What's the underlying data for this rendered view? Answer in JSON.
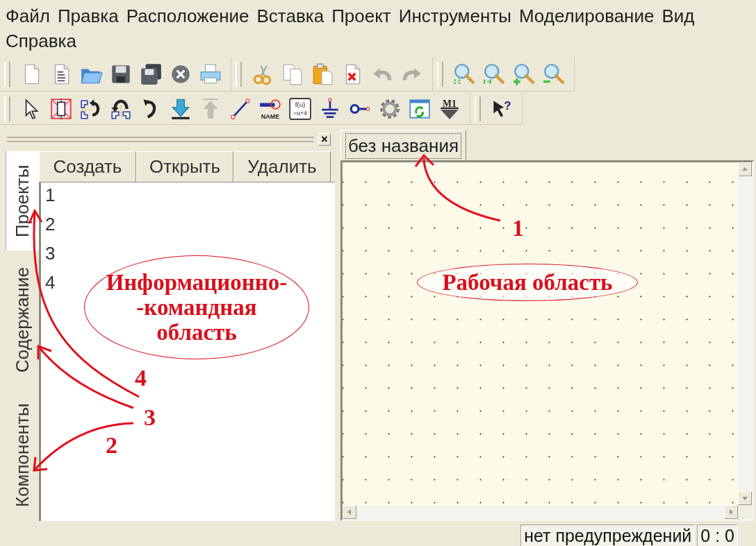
{
  "menu": [
    {
      "label": "Файл"
    },
    {
      "label": "Правка"
    },
    {
      "label": "Расположение"
    },
    {
      "label": "Вставка"
    },
    {
      "label": "Проект"
    },
    {
      "label": "Инструменты"
    },
    {
      "label": "Моделирование"
    },
    {
      "label": "Вид"
    },
    {
      "label": "Справка"
    }
  ],
  "toolbars": [
    {
      "groups": [
        [
          {
            "kind": "new-file",
            "disabled": false
          },
          {
            "kind": "report",
            "disabled": false
          },
          {
            "kind": "open-folder",
            "disabled": false
          },
          {
            "kind": "save",
            "disabled": false
          },
          {
            "kind": "save-all",
            "disabled": false
          },
          {
            "kind": "close-circle",
            "disabled": false
          },
          {
            "kind": "print",
            "disabled": false
          }
        ],
        [
          {
            "kind": "cut",
            "disabled": false
          },
          {
            "kind": "copy",
            "disabled": false
          },
          {
            "kind": "paste",
            "disabled": false
          },
          {
            "kind": "delete-file",
            "disabled": false
          },
          {
            "kind": "undo",
            "disabled": true
          },
          {
            "kind": "redo",
            "disabled": true
          }
        ],
        [
          {
            "kind": "zoom-fit",
            "disabled": false
          },
          {
            "kind": "zoom-actual",
            "disabled": false
          },
          {
            "kind": "zoom-in",
            "disabled": false
          },
          {
            "kind": "zoom-out",
            "disabled": false
          }
        ]
      ]
    },
    {
      "groups": [
        [
          {
            "kind": "pointer",
            "disabled": false
          },
          {
            "kind": "component",
            "disabled": false
          },
          {
            "kind": "flip-horizontal",
            "disabled": false
          },
          {
            "kind": "flip-vertical",
            "disabled": false
          },
          {
            "kind": "rotate",
            "disabled": false
          },
          {
            "kind": "arrow-down",
            "disabled": false
          },
          {
            "kind": "arrow-up",
            "disabled": true
          },
          {
            "kind": "wire",
            "disabled": false
          },
          {
            "kind": "net-name",
            "disabled": false,
            "text": [
              "NAME"
            ]
          },
          {
            "kind": "function",
            "disabled": false,
            "text": [
              "f(u)",
              "=u+4"
            ]
          },
          {
            "kind": "ground",
            "disabled": false
          },
          {
            "kind": "pin",
            "disabled": false
          },
          {
            "kind": "gear",
            "disabled": false
          },
          {
            "kind": "window-refresh",
            "disabled": false
          },
          {
            "kind": "marker",
            "disabled": false,
            "text": [
              "M1"
            ]
          }
        ],
        [
          {
            "kind": "help-pointer",
            "disabled": false,
            "text": [
              "?"
            ]
          }
        ]
      ]
    }
  ],
  "panel": {
    "close": "×",
    "tabs": [
      {
        "label": "Проекты",
        "selected": true
      },
      {
        "label": "Содержание",
        "selected": false
      },
      {
        "label": "Компоненты",
        "selected": false
      }
    ],
    "buttons": [
      "Создать",
      "Открыть",
      "Удалить"
    ],
    "items": [
      "1",
      "2",
      "3",
      "4"
    ]
  },
  "documents": {
    "tabs": [
      {
        "label": "без названия",
        "selected": true
      }
    ]
  },
  "status_bar": {
    "message": "нет предупреждений",
    "position": "0 : 0"
  },
  "annotations": {
    "callouts": [
      {
        "lines": [
          "Информационно-",
          "-командная",
          "область"
        ]
      },
      {
        "lines": [
          "Рабочая область"
        ]
      }
    ],
    "numbers": [
      "1",
      "4",
      "3",
      "2"
    ]
  }
}
